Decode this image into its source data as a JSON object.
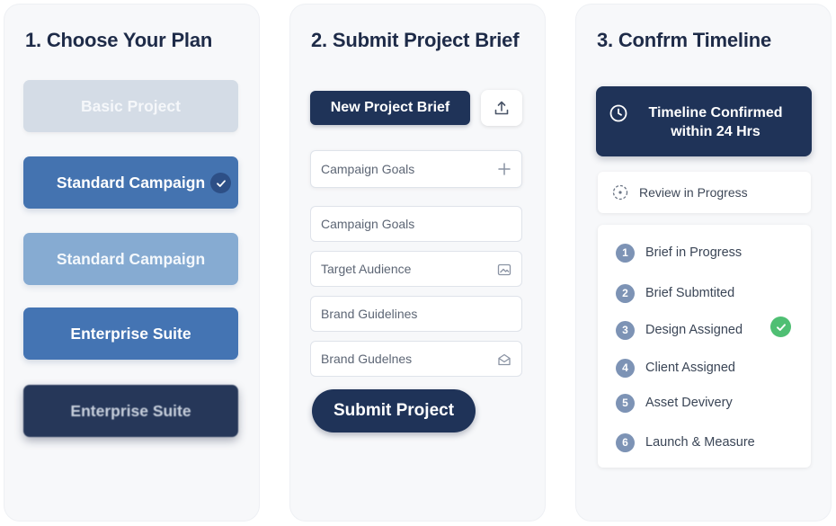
{
  "panels": {
    "choose_plan": {
      "title": "1. Choose Your Plan",
      "options": [
        {
          "label": "Basic Project",
          "state": "disabled"
        },
        {
          "label": "Standard Campaign",
          "state": "selected"
        },
        {
          "label": "Standard Campaign",
          "state": "light"
        },
        {
          "label": "Enterprise Suite",
          "state": "default"
        },
        {
          "label": "Enterprise Suite",
          "state": "dark-blurred"
        }
      ]
    },
    "submit_brief": {
      "title": "2. Submit Project Brief",
      "new_brief_label": "New Project Brief",
      "upload_icon": "upload-icon",
      "fields": [
        {
          "placeholder": "Campaign Goals",
          "icon": "plus-icon"
        },
        {
          "placeholder": "Campaign Goals",
          "icon": ""
        },
        {
          "placeholder": "Target Audience",
          "icon": "image-icon"
        },
        {
          "placeholder": "Brand Guidelines",
          "icon": ""
        },
        {
          "placeholder": "Brand Gudelnes",
          "icon": "mail-icon"
        }
      ],
      "submit_label": "Submit Project"
    },
    "confirm_timeline": {
      "title": "3. Confrm Timeline",
      "confirmed_line1": "Timeline Confirmed",
      "confirmed_line2": "within 24 Hrs",
      "review_label": "Review in Progress",
      "steps": [
        {
          "num": "1",
          "label": "Brief in Progress"
        },
        {
          "num": "2",
          "label": "Brief Submtited"
        },
        {
          "num": "3",
          "label": "Design Assigned",
          "done": true
        },
        {
          "num": "4",
          "label": "Client Assigned"
        },
        {
          "num": "5",
          "label": "Asset Devivery"
        },
        {
          "num": "6",
          "label": "Launch & Measure"
        }
      ]
    }
  },
  "colors": {
    "navy": "#1f3358",
    "blue": "#4473b0",
    "light_blue": "#86abd2",
    "disabled": "#d4dce6",
    "success": "#4fbf73"
  }
}
